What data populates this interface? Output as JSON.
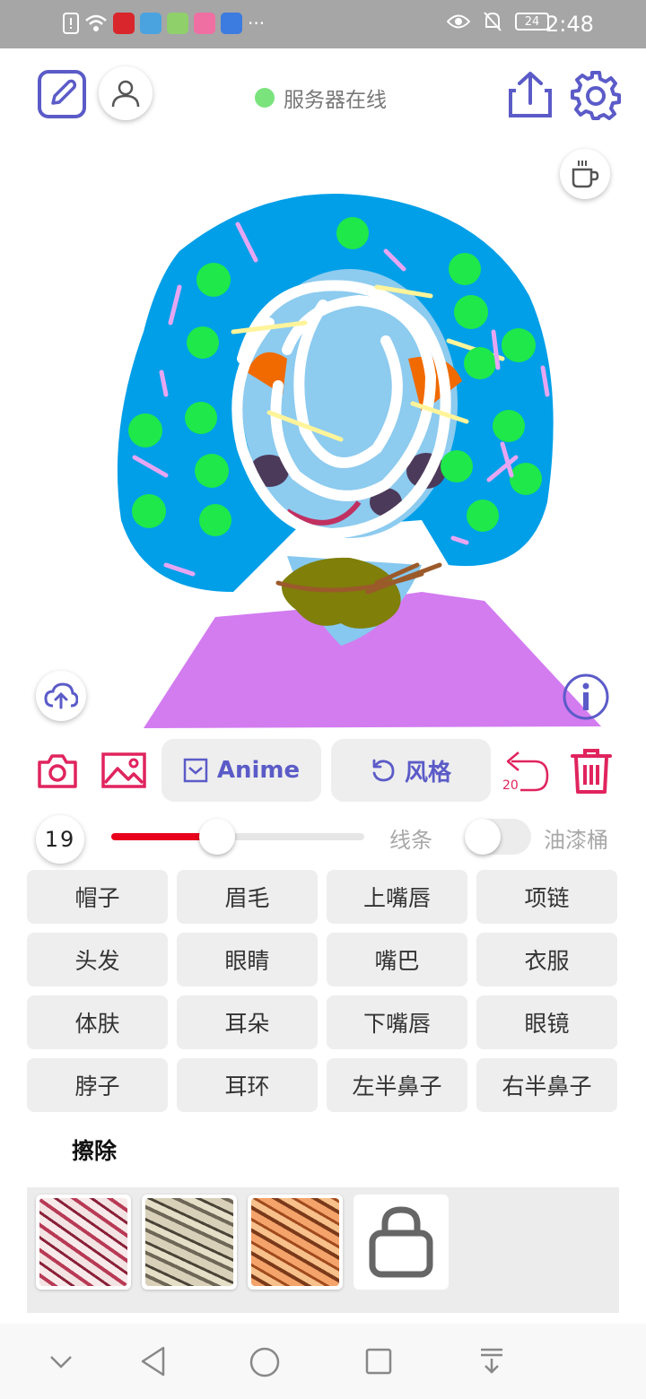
{
  "status_bar": {
    "battery": "24",
    "time": "2:48"
  },
  "header": {
    "server_status": "服务器在线"
  },
  "toolbar": {
    "model_label": "Anime",
    "style_label": "风格",
    "undo_count": "20"
  },
  "brush": {
    "size": "19",
    "size_fraction": 0.39,
    "lines_label": "线条",
    "bucket_label": "油漆桶",
    "bucket_enabled": false
  },
  "parts": [
    "帽子",
    "眉毛",
    "上嘴唇",
    "项链",
    "头发",
    "眼睛",
    "嘴巴",
    "衣服",
    "体肤",
    "耳朵",
    "下嘴唇",
    "眼镜",
    "脖子",
    "耳环",
    "左半鼻子",
    "右半鼻子"
  ],
  "erase_label": "擦除",
  "colors": {
    "accent": "#5b5bc8",
    "danger": "#e0245e",
    "slider": "#e8001c",
    "online": "#7ae37c"
  },
  "icons": {
    "top_left": [
      "edit-icon",
      "user-icon"
    ],
    "top_right": [
      "share-icon",
      "settings-icon"
    ],
    "canvas": [
      "coffee-icon",
      "cloud-upload-icon",
      "info-icon"
    ],
    "toolbar": [
      "camera-icon",
      "image-icon",
      "model-icon",
      "refresh-icon",
      "undo-icon",
      "trash-icon"
    ],
    "styles": [
      "style-thumb-1",
      "style-thumb-2",
      "style-thumb-3",
      "lock-icon"
    ],
    "nav": [
      "chevron-down-icon",
      "back-icon",
      "home-icon",
      "recents-icon",
      "notification-down-icon"
    ]
  }
}
